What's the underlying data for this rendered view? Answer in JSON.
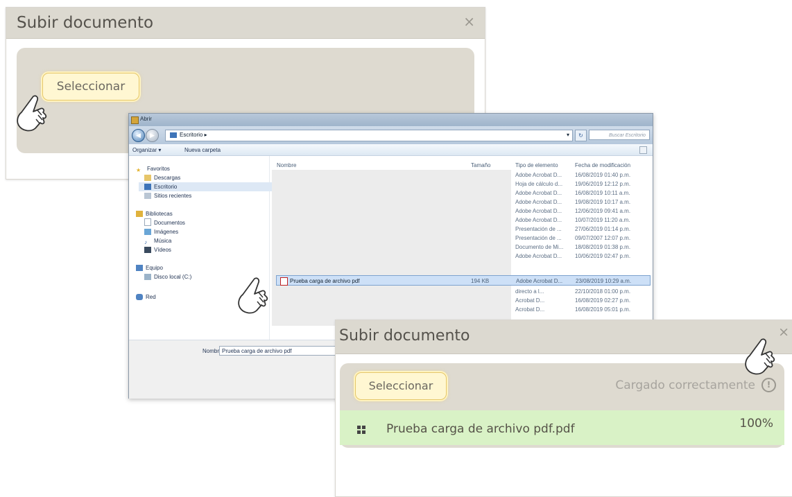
{
  "dialog1": {
    "title": "Subir documento",
    "close": "×",
    "select_label": "Seleccionar"
  },
  "explorer": {
    "title": "Abrir",
    "breadcrumb": "Escritorio ▸",
    "search_placeholder": "Buscar Escritorio",
    "toolbar": {
      "organize": "Organizar ▾",
      "new_folder": "Nueva carpeta"
    },
    "nav": {
      "favorites": "Favoritos",
      "downloads": "Descargas",
      "desktop": "Escritorio",
      "recent": "Sitios recientes",
      "libraries": "Bibliotecas",
      "documents": "Documentos",
      "images": "Imágenes",
      "music": "Música",
      "videos": "Vídeos",
      "computer": "Equipo",
      "local_disk": "Disco local (C:)",
      "network": "Red"
    },
    "columns": {
      "name": "Nombre",
      "size": "Tamaño",
      "type": "Tipo de elemento",
      "date": "Fecha de modificación"
    },
    "rows": [
      {
        "type": "Adobe Acrobat D...",
        "date": "16/08/2019 01:40 p.m."
      },
      {
        "type": "Hoja de cálculo d...",
        "date": "19/06/2019 12:12 p.m."
      },
      {
        "type": "Adobe Acrobat D...",
        "date": "16/08/2019 10:11 a.m."
      },
      {
        "type": "Adobe Acrobat D...",
        "date": "19/08/2019 10:17 a.m."
      },
      {
        "type": "Adobe Acrobat D...",
        "date": "12/06/2019 09:41 a.m."
      },
      {
        "type": "Adobe Acrobat D...",
        "date": "10/07/2019 11:20 a.m."
      },
      {
        "type": "Presentación de ...",
        "date": "27/06/2019 01:14 p.m."
      },
      {
        "type": "Presentación de ...",
        "date": "09/07/2007 12:07 p.m."
      },
      {
        "type": "Documento de Mi...",
        "date": "18/08/2019 01:38 p.m."
      },
      {
        "type": "Adobe Acrobat D...",
        "date": "10/06/2019 02:47 p.m."
      }
    ],
    "selected": {
      "name": "Prueba carga de archivo pdf",
      "size": "194 KB",
      "type": "Adobe Acrobat D...",
      "date": "23/08/2019 10:29 a.m."
    },
    "after_rows": [
      {
        "type": "directo a l...",
        "date": "22/10/2018 01:00 p.m."
      },
      {
        "type": "Acrobat D...",
        "date": "16/08/2019 02:27 p.m."
      },
      {
        "type": "Acrobat D...",
        "date": "16/08/2019 05:01 p.m."
      }
    ],
    "filename_label": "Nombre:",
    "filename_value": "Prueba carga de archivo pdf"
  },
  "dialog2": {
    "title": "Subir documento",
    "close": "×",
    "select_label": "Seleccionar",
    "status": "Cargado correctamente",
    "status_icon": "!",
    "file_name": "Prueba carga de archivo pdf.pdf",
    "progress": "100%"
  },
  "colors": {
    "header": "#dcd9d0",
    "panel": "#dedad0",
    "success": "#d9f2c6",
    "button_glow": "#e5c76a"
  }
}
